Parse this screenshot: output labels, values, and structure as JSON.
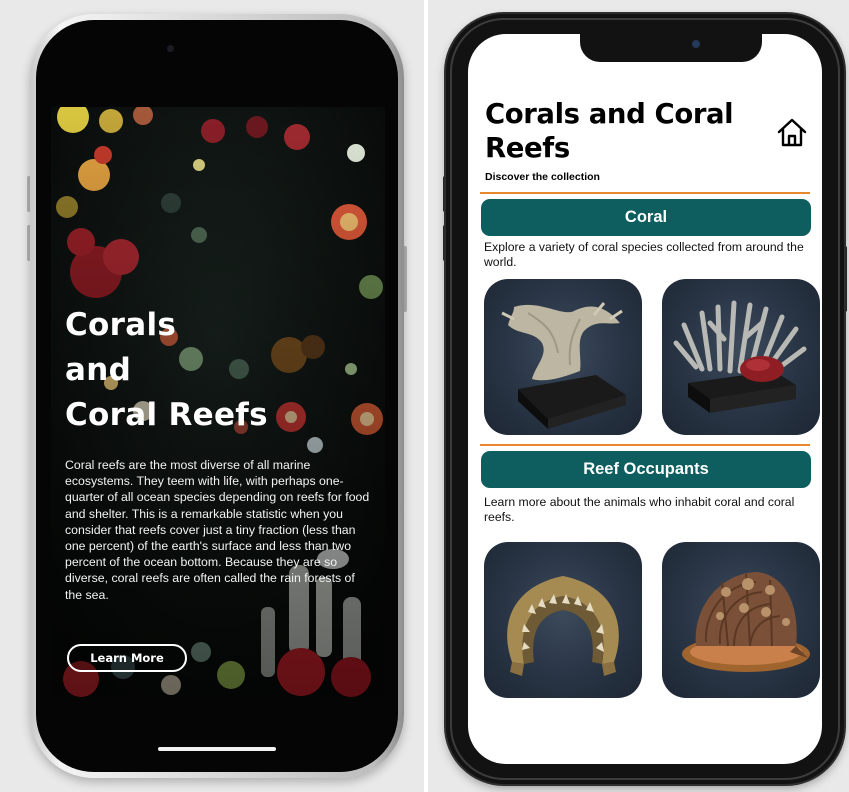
{
  "left_screen": {
    "hero_title_lines": [
      "Corals",
      "and",
      "Coral Reefs"
    ],
    "hero_body": "Coral reefs are the most diverse of all marine ecosystems. They teem with life, with perhaps one-quarter of all ocean species depending on reefs for food and shelter. This is a remarkable statistic when you consider that reefs cover just a tiny fraction (less than one percent) of the earth's surface and less than two percent of the ocean bottom. Because they are so diverse, coral reefs are often called the rain forests of the sea.",
    "learn_more_label": "Learn More"
  },
  "right_screen": {
    "title": "Corals and Coral Reefs",
    "subtitle": "Discover the collection",
    "home_icon": "home-icon",
    "sections": [
      {
        "label": "Coral",
        "description": "Explore a variety of coral species collected from around the world.",
        "cards": [
          {
            "icon": "fan-coral-specimen"
          },
          {
            "icon": "branching-coral-specimen"
          }
        ]
      },
      {
        "label": "Reef Occupants",
        "description": "Learn more about the animals who inhabit coral and coral reefs.",
        "cards": [
          {
            "icon": "shark-jaw-specimen"
          },
          {
            "icon": "conch-shell-specimen"
          }
        ]
      }
    ]
  },
  "colors": {
    "accent_teal": "#0e5e5f",
    "divider_orange": "#e8872d",
    "card_background": "#283444",
    "hero_background": "#0b0d0c"
  }
}
